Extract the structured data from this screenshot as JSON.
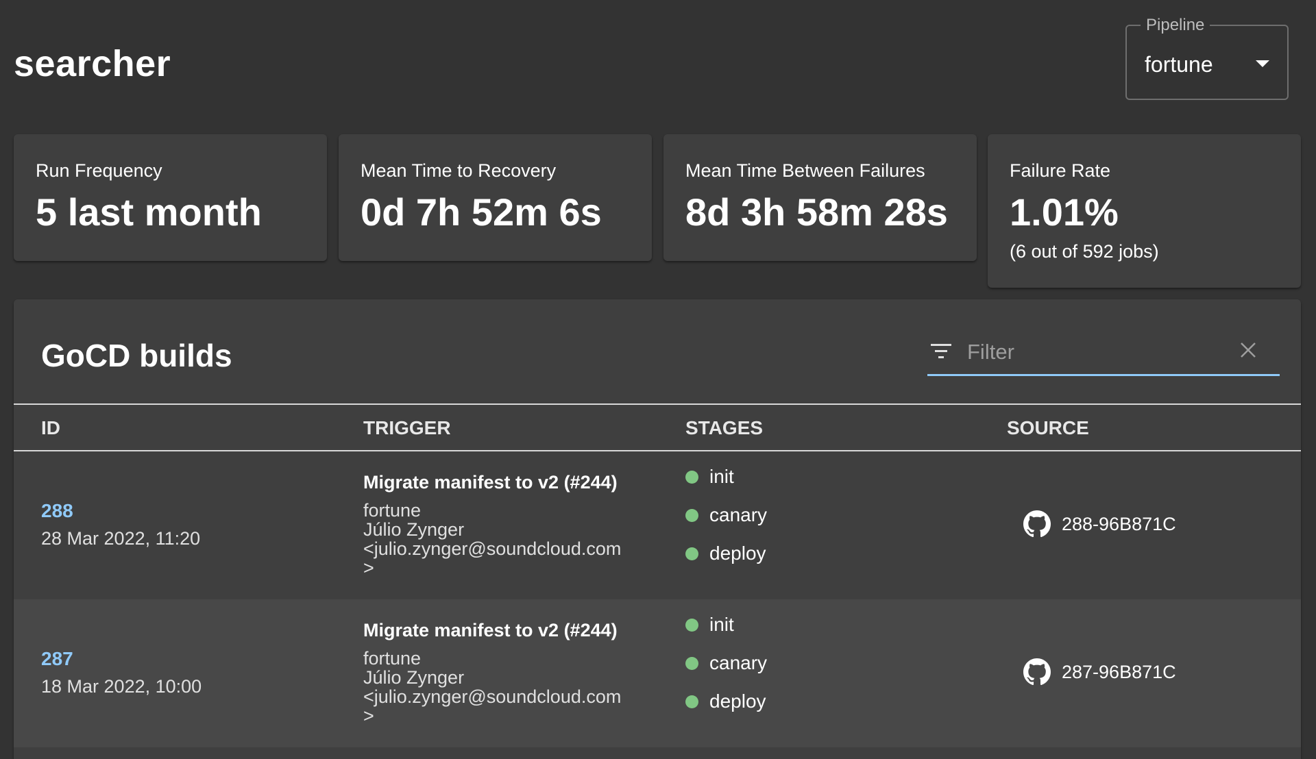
{
  "page": {
    "title": "searcher"
  },
  "pipeline": {
    "label": "Pipeline",
    "value": "fortune"
  },
  "metrics": [
    {
      "label": "Run Frequency",
      "value": "5 last month"
    },
    {
      "label": "Mean Time to Recovery",
      "value": "0d 7h 52m 6s"
    },
    {
      "label": "Mean Time Between Failures",
      "value": "8d 3h 58m 28s"
    },
    {
      "label": "Failure Rate",
      "value": "1.01%",
      "sub": "(6 out of 592 jobs)"
    }
  ],
  "builds": {
    "title": "GoCD builds",
    "filter": {
      "placeholder": "Filter",
      "value": ""
    },
    "columns": [
      "ID",
      "TRIGGER",
      "STAGES",
      "SOURCE"
    ],
    "rows": [
      {
        "id": "288",
        "date": "28 Mar 2022, 11:20",
        "trigger_title": "Migrate manifest to v2 (#244)",
        "trigger_pipeline": "fortune",
        "trigger_author": "Júlio Zynger",
        "trigger_email": "<julio.zynger@soundcloud.com",
        "trigger_email_end": ">",
        "stages": [
          {
            "name": "init",
            "status": "passed"
          },
          {
            "name": "canary",
            "status": "passed"
          },
          {
            "name": "deploy",
            "status": "passed"
          }
        ],
        "source": "288-96B871C"
      },
      {
        "id": "287",
        "date": "18 Mar 2022, 10:00",
        "trigger_title": "Migrate manifest to v2 (#244)",
        "trigger_pipeline": "fortune",
        "trigger_author": "Júlio Zynger",
        "trigger_email": "<julio.zynger@soundcloud.com",
        "trigger_email_end": ">",
        "stages": [
          {
            "name": "init",
            "status": "passed"
          },
          {
            "name": "canary",
            "status": "passed"
          },
          {
            "name": "deploy",
            "status": "passed"
          }
        ],
        "source": "287-96B871C"
      }
    ]
  },
  "colors": {
    "background": "#333333",
    "card": "#3f3f3f",
    "link": "#90caf9",
    "stage_passed": "#81c784"
  },
  "icons": {
    "filter": "filter-list-icon",
    "clear": "close-icon",
    "source": "github-icon"
  }
}
